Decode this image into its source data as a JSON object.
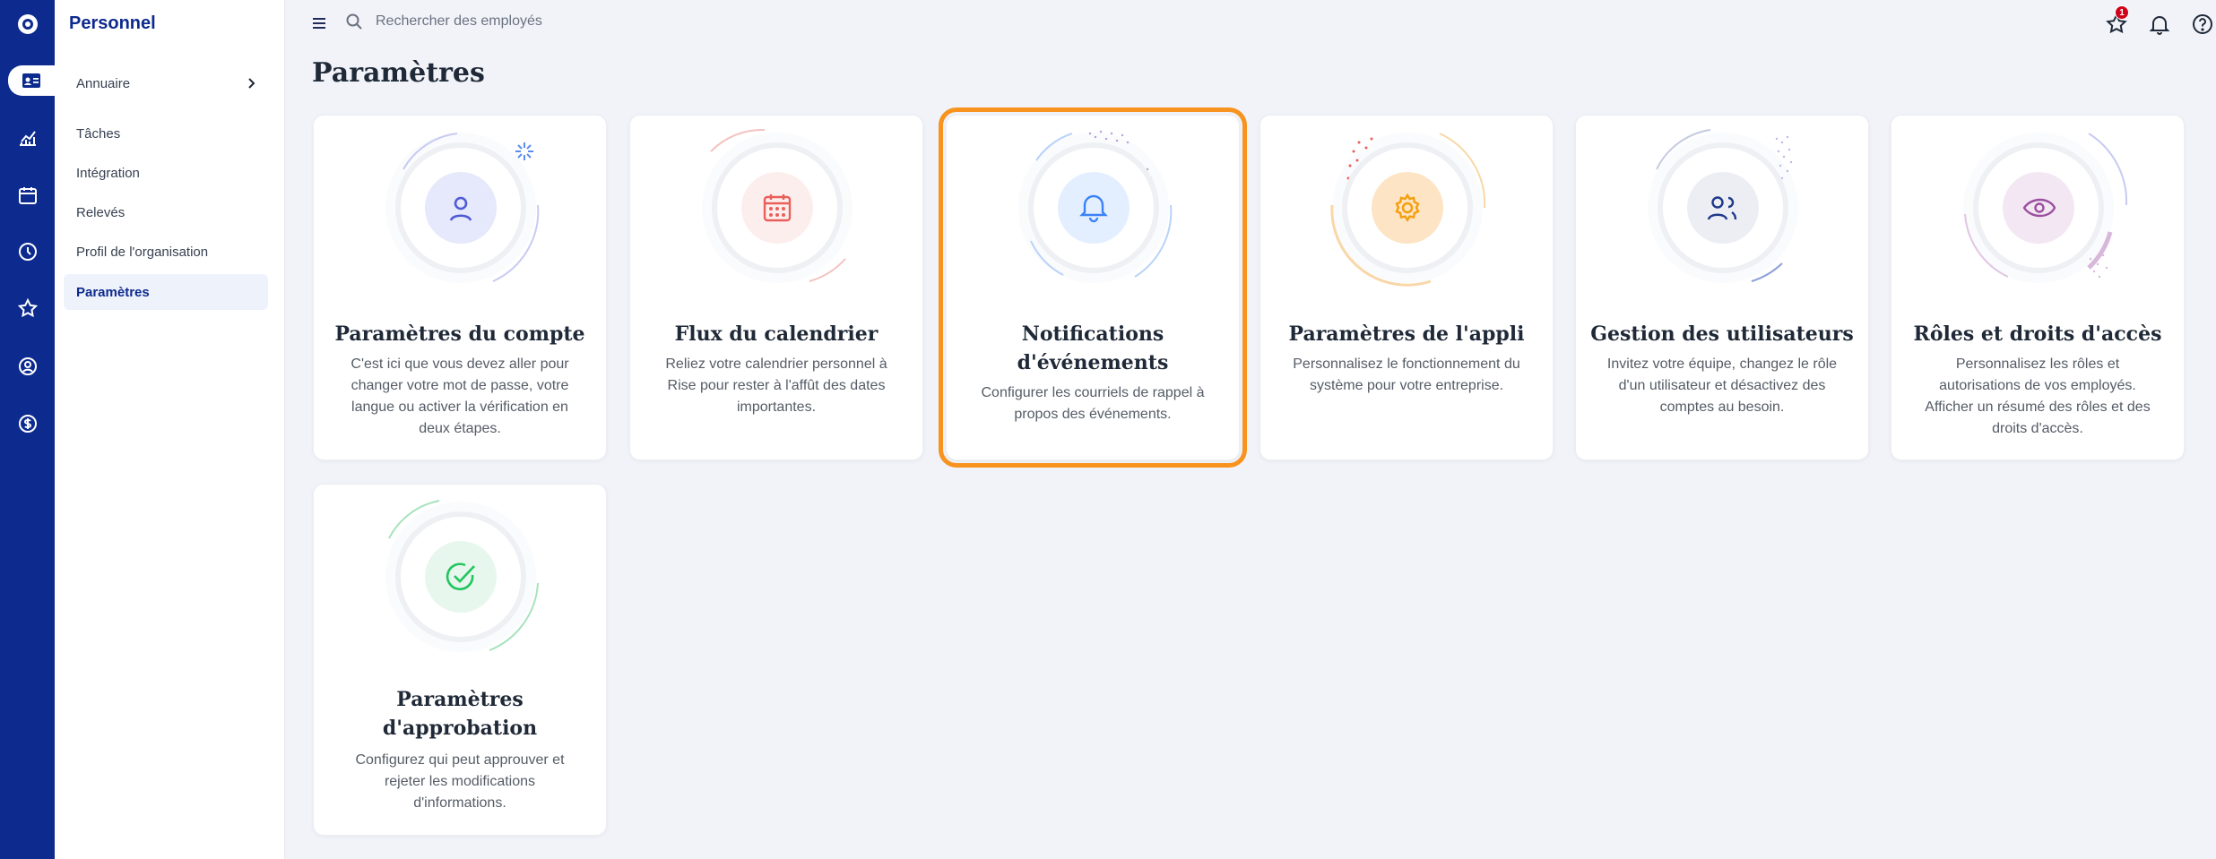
{
  "app": {
    "section_title": "Personnel"
  },
  "sidebar": {
    "items": [
      {
        "label": "Annuaire"
      },
      {
        "label": "Tâches"
      },
      {
        "label": "Intégration"
      },
      {
        "label": "Relevés"
      },
      {
        "label": "Profil de l'organisation"
      },
      {
        "label": "Paramètres"
      }
    ]
  },
  "search": {
    "placeholder": "Rechercher des employés"
  },
  "header": {
    "favorites_badge": "1"
  },
  "page": {
    "title": "Paramètres"
  },
  "cards": [
    {
      "title": "Paramètres du compte",
      "description": "C'est ici que vous devez aller pour changer votre mot de passe, votre langue ou activer la vérification en deux étapes.",
      "icon": "user-icon",
      "accent": "#4f5bd5",
      "tint": "#e6e8fb"
    },
    {
      "title": "Flux du calendrier",
      "description": "Reliez votre calendrier personnel à Rise pour rester à l'affût des dates importantes.",
      "icon": "calendar-icon",
      "accent": "#e8605a",
      "tint": "#fdeeee"
    },
    {
      "title": "Notifications d'événements",
      "description": "Configurer les courriels de rappel à propos des événements.",
      "icon": "bell-icon",
      "accent": "#3b82f6",
      "tint": "#e3efff"
    },
    {
      "title": "Paramètres de l'appli",
      "description": "Personnalisez le fonctionnement du système pour votre entreprise.",
      "icon": "gear-icon",
      "accent": "#f59e0b",
      "tint": "#fde4c4"
    },
    {
      "title": "Gestion des utilisateurs",
      "description": "Invitez votre équipe, changez le rôle d'un utilisateur et désactivez des comptes au besoin.",
      "icon": "users-icon",
      "accent": "#1e3a8a",
      "tint": "#eceef3"
    },
    {
      "title": "Rôles et droits d'accès",
      "description": "Personnalisez les rôles et autorisations de vos employés. Afficher un résumé des rôles et des droits d'accès.",
      "icon": "eye-icon",
      "accent": "#9b4f9f",
      "tint": "#f3e7f3"
    },
    {
      "title": "Paramètres d'approbation",
      "description": "Configurez qui peut approuver et rejeter les modifications d'informations.",
      "icon": "check-circle-icon",
      "accent": "#22c55e",
      "tint": "#e8f7ee"
    }
  ],
  "colors": {
    "brand": "#0d2a8e",
    "highlight": "#f7931e",
    "badge": "#d0021b"
  }
}
